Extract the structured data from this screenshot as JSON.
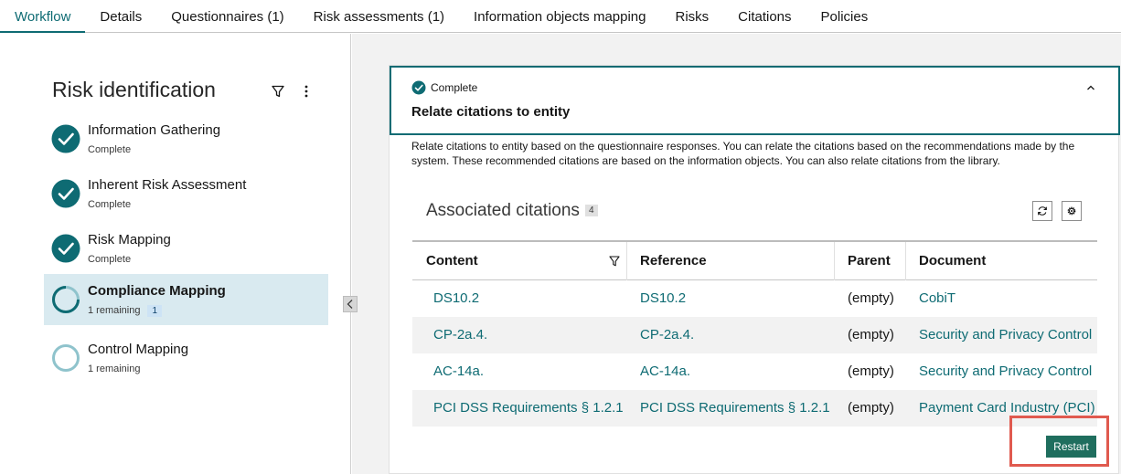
{
  "tabs": [
    {
      "label": "Workflow"
    },
    {
      "label": "Details"
    },
    {
      "label": "Questionnaires (1)"
    },
    {
      "label": "Risk assessments (1)"
    },
    {
      "label": "Information objects mapping"
    },
    {
      "label": "Risks"
    },
    {
      "label": "Citations"
    },
    {
      "label": "Policies"
    }
  ],
  "sidebar": {
    "title": "Risk identification",
    "steps": [
      {
        "name": "Information Gathering",
        "status": "Complete"
      },
      {
        "name": "Inherent Risk Assessment",
        "status": "Complete"
      },
      {
        "name": "Risk Mapping",
        "status": "Complete"
      },
      {
        "name": "Compliance Mapping",
        "status": "1 remaining",
        "badge": "1"
      },
      {
        "name": "Control Mapping",
        "status": "1 remaining"
      }
    ]
  },
  "card": {
    "status": "Complete",
    "title": "Relate citations to entity",
    "description": "Relate citations to entity based on the questionnaire responses. You can relate the citations based on the recommendations made by the system. These recommended citations are based on the information objects. You can also relate citations from the library."
  },
  "citations": {
    "title": "Associated citations",
    "count": "4",
    "columns": {
      "content": "Content",
      "reference": "Reference",
      "parent": "Parent",
      "document": "Document"
    },
    "rows": [
      {
        "content": "DS10.2",
        "reference": "DS10.2",
        "parent": "(empty)",
        "document": "CobiT"
      },
      {
        "content": "CP-2a.4.",
        "reference": "CP-2a.4.",
        "parent": "(empty)",
        "document": "Security and Privacy Control"
      },
      {
        "content": "AC-14a.",
        "reference": "AC-14a.",
        "parent": "(empty)",
        "document": "Security and Privacy Control"
      },
      {
        "content": "PCI DSS Requirements § 1.2.1",
        "reference": "PCI DSS Requirements § 1.2.1",
        "parent": "(empty)",
        "document": "Payment Card Industry (PCI)"
      }
    ]
  },
  "actions": {
    "restart_label": "Restart"
  },
  "colors": {
    "accent": "#0e6b73",
    "button": "#1f6e5e",
    "highlight": "#e05a4f",
    "selected_step": "#d9eaf0"
  }
}
